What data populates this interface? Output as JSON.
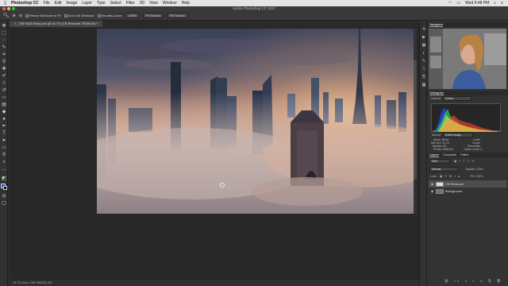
{
  "menubar": {
    "apple": "",
    "app": "Photoshop CC",
    "items": [
      "File",
      "Edit",
      "Image",
      "Layer",
      "Type",
      "Select",
      "Filter",
      "3D",
      "View",
      "Window",
      "Help"
    ],
    "clock": "Wed 5:48 PM"
  },
  "window": {
    "title": "Adobe Photoshop CC 2017"
  },
  "options": {
    "resize_windows": "Resize Windows to Fit",
    "zoom_all": "Zoom All Windows",
    "scrubby_zoom": "Scrubby Zoom",
    "pct_button": "100%",
    "fit_button": "Fit Screen",
    "fill_button": "Fill Screen"
  },
  "document": {
    "tab": "_DSF4026-Pano.psd @ 16.7% (CB Removal, RGB/16*) *",
    "status": "16.7%    Doc: 156.9M/261.2M"
  },
  "panels": {
    "navigator_tab": "Navigator",
    "histogram_tab": "Histogram",
    "channel_label": "Channel:",
    "channel_value": "Colors",
    "stats": {
      "source": "Source:",
      "source_value": "Entire Image",
      "mean": "Mean: 88.44",
      "std_dev": "Std Dev: 51.21",
      "median": "Median: 84",
      "pixels": "Pixels: 4396415",
      "level": "Level:",
      "count": "Count:",
      "percentile": "Percentile:",
      "cache_level": "Cache Level: 4"
    },
    "layers_tabs": [
      "Layers",
      "Channels",
      "Paths"
    ],
    "kind": "Kind",
    "blend_mode": "Normal",
    "opacity": "Opacity: 100%",
    "lock": "Lock:",
    "fill": "Fill: 100%",
    "layers": [
      {
        "name": "CB Removal"
      },
      {
        "name": "Background"
      }
    ]
  },
  "colors": {
    "fg": "#1f4bd6",
    "accent": "#4a90e2"
  }
}
